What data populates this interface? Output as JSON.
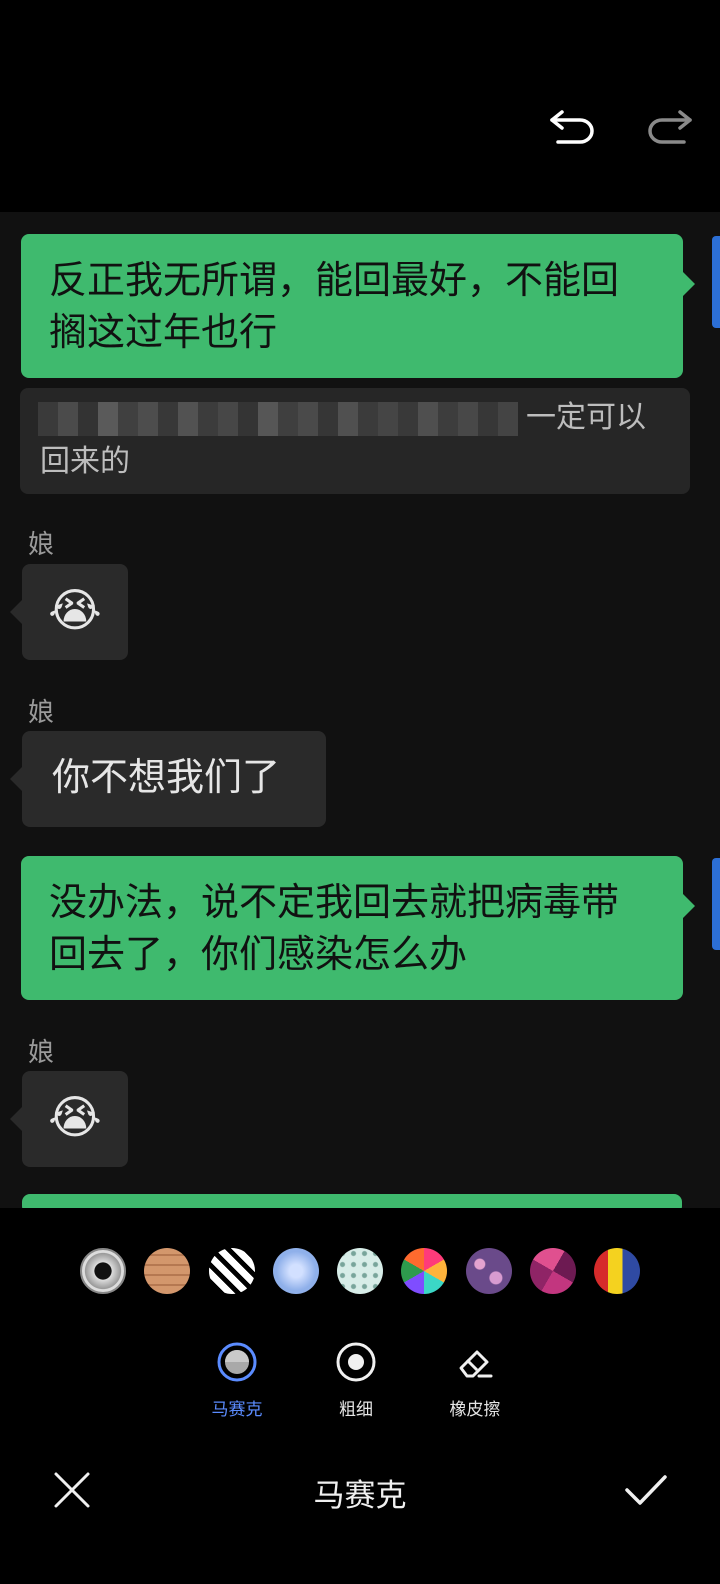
{
  "chat": {
    "msg1": "反正我无所谓，能回最好，不能回搁这过年也行",
    "quote_text_visible": "一定可以",
    "quote_text_line2": "回来的",
    "sender1": "娘",
    "emoji1": "😭",
    "sender2": "娘",
    "msg2": "你不想我们了",
    "msg3": "没办法，说不定我回去就把病毒带回去了，你们感染怎么办",
    "sender3": "娘",
    "emoji2": "😭"
  },
  "toolbar": {
    "swatches": [
      "ring-mosaic",
      "skin-mosaic",
      "black-white-mosaic",
      "blue-gem",
      "dotted-mint",
      "colorful-triangles",
      "purple-floral",
      "magenta-triangles",
      "color-blocks"
    ],
    "tools": [
      {
        "label": "马赛克",
        "active": true,
        "icon": "mosaic-icon"
      },
      {
        "label": "粗细",
        "active": false,
        "icon": "brush-size-icon"
      },
      {
        "label": "橡皮擦",
        "active": false,
        "icon": "eraser-icon"
      }
    ],
    "title": "马赛克"
  },
  "colors": {
    "green_bubble": "#3fba6e",
    "accent_blue": "#5b8cff"
  }
}
